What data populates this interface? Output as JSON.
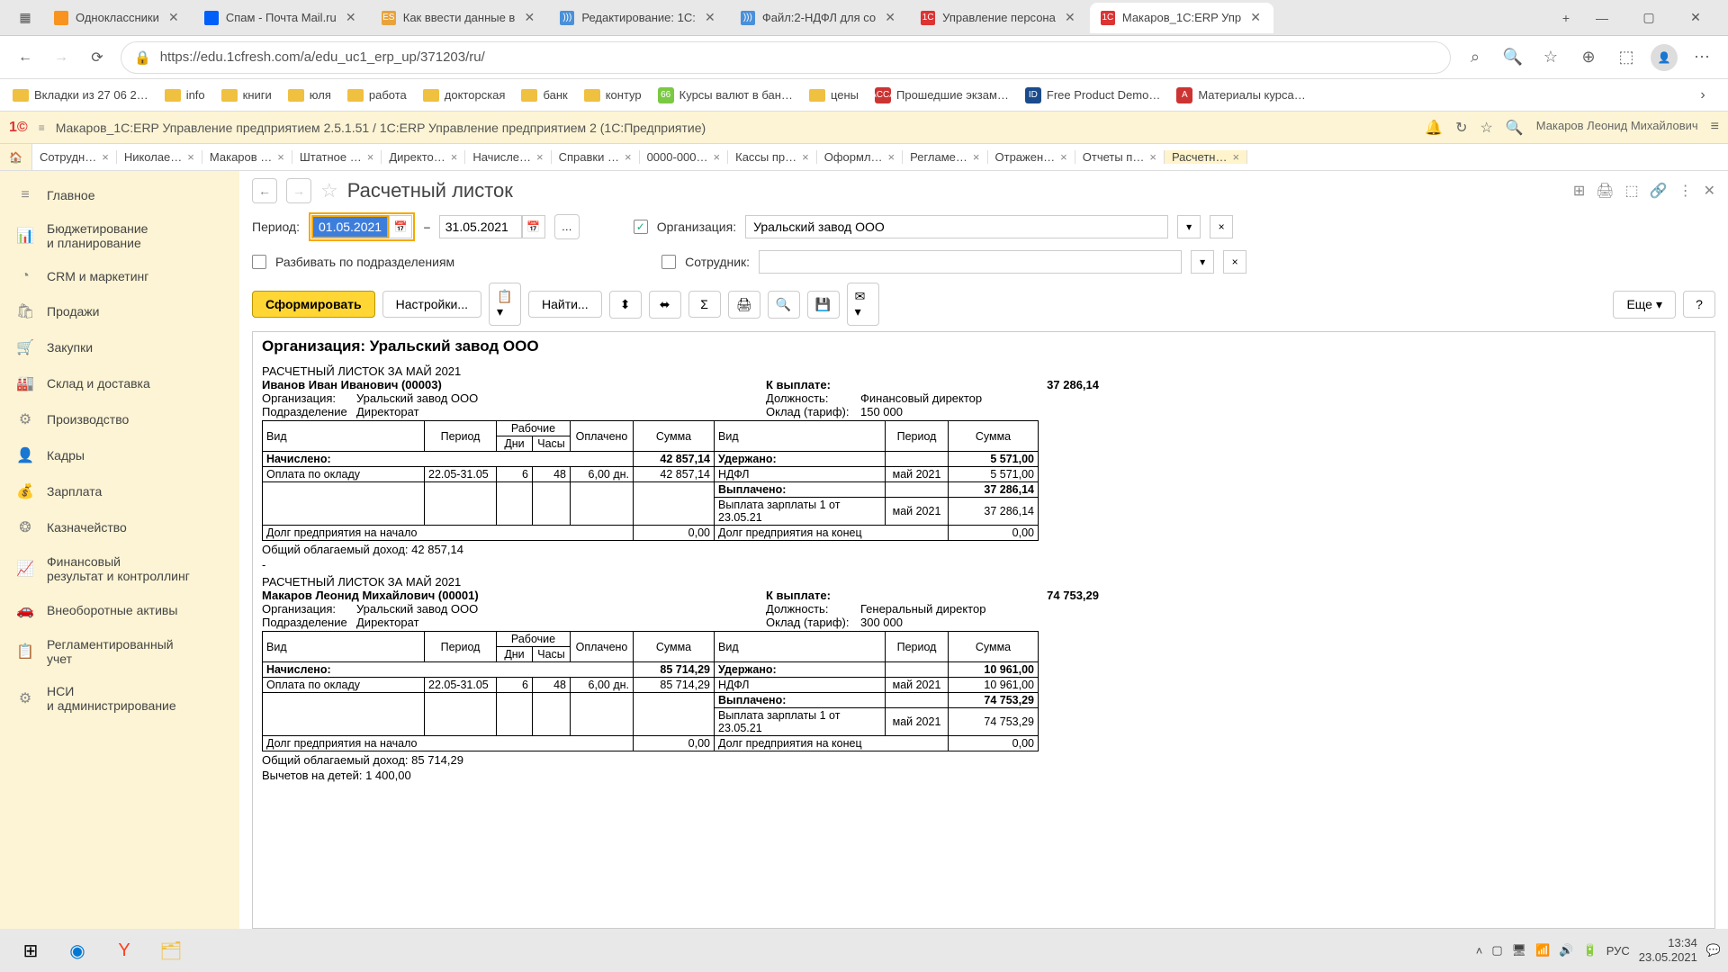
{
  "browser": {
    "tabs": [
      {
        "label": "Одноклассники",
        "color": "#f7931e"
      },
      {
        "label": "Спам - Почта Mail.ru",
        "color": "#005ff9"
      },
      {
        "label": "Как ввести данные в",
        "color": "#e8a33d",
        "initial": "ES"
      },
      {
        "label": "Редактирование: 1С:",
        "color": "#4a90d9",
        "initial": ")))"
      },
      {
        "label": "Файл:2-НДФЛ для со",
        "color": "#4a90d9",
        "initial": ")))"
      },
      {
        "label": "Управление персона",
        "color": "#d33",
        "initial": "1С"
      },
      {
        "label": "Макаров_1С:ERP Упр",
        "color": "#d33",
        "initial": "1С",
        "active": true
      }
    ],
    "url": "https://edu.1cfresh.com/a/edu_uc1_erp_up/371203/ru/",
    "bookmarks": [
      {
        "label": "Вкладки из 27 06 2…",
        "type": "folder"
      },
      {
        "label": "info",
        "type": "folder"
      },
      {
        "label": "книги",
        "type": "folder"
      },
      {
        "label": "юля",
        "type": "folder"
      },
      {
        "label": "работа",
        "type": "folder"
      },
      {
        "label": "докторская",
        "type": "folder"
      },
      {
        "label": "банк",
        "type": "folder"
      },
      {
        "label": "контур",
        "type": "folder"
      },
      {
        "label": "Курсы валют в бан…",
        "type": "link",
        "color": "#7ac943",
        "initial": "66"
      },
      {
        "label": "цены",
        "type": "folder"
      },
      {
        "label": "Прошедшие экзам…",
        "type": "link",
        "color": "#c33",
        "initial": "ACCA"
      },
      {
        "label": "Free Product Demo…",
        "type": "link",
        "color": "#1a4b8c",
        "initial": "ID"
      },
      {
        "label": "Материалы курса…",
        "type": "link",
        "color": "#c33",
        "initial": "А"
      }
    ]
  },
  "app": {
    "title": "Макаров_1С:ERP Управление предприятием 2.5.1.51 / 1С:ERP Управление предприятием 2   (1С:Предприятие)",
    "user": "Макаров Леонид Михайлович",
    "tabs": [
      "Сотрудн…",
      "Николае…",
      "Макаров …",
      "Штатное …",
      "Директо…",
      "Начисле…",
      "Справки …",
      "0000-000…",
      "Кассы пр…",
      "Оформл…",
      "Регламе…",
      "Отражен…",
      "Отчеты п…",
      "Расчетн…"
    ]
  },
  "sidebar": [
    {
      "label": "Главное",
      "icon": "≡"
    },
    {
      "label": "Бюджетирование\nи планирование",
      "icon": "📊"
    },
    {
      "label": "CRM и маркетинг",
      "icon": "◔"
    },
    {
      "label": "Продажи",
      "icon": "🛍"
    },
    {
      "label": "Закупки",
      "icon": "🛒"
    },
    {
      "label": "Склад и доставка",
      "icon": "🏭"
    },
    {
      "label": "Производство",
      "icon": "⚙"
    },
    {
      "label": "Кадры",
      "icon": "👤"
    },
    {
      "label": "Зарплата",
      "icon": "💰"
    },
    {
      "label": "Казначейство",
      "icon": "❂"
    },
    {
      "label": "Финансовый\nрезультат и контроллинг",
      "icon": "📈"
    },
    {
      "label": "Внеоборотные активы",
      "icon": "🚗"
    },
    {
      "label": "Регламентированный\nучет",
      "icon": "📋"
    },
    {
      "label": "НСИ\nи администрирование",
      "icon": "⚙"
    }
  ],
  "page": {
    "title": "Расчетный листок",
    "period_label": "Период:",
    "period_from": "01.05.2021",
    "period_to": "31.05.2021",
    "org_chk": "✓",
    "org_label": "Организация:",
    "org_value": "Уральский завод ООО",
    "split_label": "Разбивать по подразделениям",
    "empl_label": "Сотрудник:",
    "buttons": {
      "form": "Сформировать",
      "settings": "Настройки...",
      "find": "Найти...",
      "more": "Еще",
      "help": "?"
    }
  },
  "report": {
    "org_header": "Организация: Уральский завод ООО",
    "slip_period": "РАСЧЕТНЫЙ ЛИСТОК ЗА МАЙ 2021",
    "emp1": {
      "name": "Иванов Иван Иванович (00003)",
      "org_l": "Организация:",
      "org": "Уральский завод ООО",
      "dep_l": "Подразделение",
      "dep": "Директорат",
      "pay_l": "К выплате:",
      "pay": "37 286,14",
      "pos_l": "Должность:",
      "pos": "Финансовый директор",
      "sal_l": "Оклад (тариф):",
      "sal": "150 000",
      "headers": {
        "vid": "Вид",
        "period": "Период",
        "work": "Рабочие",
        "days": "Дни",
        "hours": "Часы",
        "paid": "Оплачено",
        "sum": "Сумма"
      },
      "acc_l": "Начислено:",
      "acc_sum": "42 857,14",
      "ded_l": "Удержано:",
      "ded_sum": "5 571,00",
      "row1": {
        "name": "Оплата по окладу",
        "period": "22.05-31.05",
        "days": "6",
        "hours": "48",
        "paid": "6,00 дн.",
        "sum": "42 857,14"
      },
      "ndfl": "НДФЛ",
      "ndfl_p": "май 2021",
      "ndfl_s": "5 571,00",
      "payout_l": "Выплачено:",
      "payout_s": "37 286,14",
      "payout_row": "Выплата зарплаты 1 от 23.05.21",
      "payout_p": "май 2021",
      "payout_rs": "37 286,14",
      "debt_start": "Долг предприятия на начало",
      "debt_start_v": "0,00",
      "debt_end": "Долг предприятия на конец",
      "debt_end_v": "0,00",
      "tax_income": "Общий облагаемый доход: 42 857,14"
    },
    "emp2": {
      "name": "Макаров Леонид Михайлович (00001)",
      "org_l": "Организация:",
      "org": "Уральский завод ООО",
      "dep_l": "Подразделение",
      "dep": "Директорат",
      "pay_l": "К выплате:",
      "pay": "74 753,29",
      "pos_l": "Должность:",
      "pos": "Генеральный директор",
      "sal_l": "Оклад (тариф):",
      "sal": "300 000",
      "acc_l": "Начислено:",
      "acc_sum": "85 714,29",
      "ded_l": "Удержано:",
      "ded_sum": "10 961,00",
      "row1": {
        "name": "Оплата по окладу",
        "period": "22.05-31.05",
        "days": "6",
        "hours": "48",
        "paid": "6,00 дн.",
        "sum": "85 714,29"
      },
      "ndfl": "НДФЛ",
      "ndfl_p": "май 2021",
      "ndfl_s": "10 961,00",
      "payout_l": "Выплачено:",
      "payout_s": "74 753,29",
      "payout_row": "Выплата зарплаты 1 от 23.05.21",
      "payout_p": "май 2021",
      "payout_rs": "74 753,29",
      "debt_start": "Долг предприятия на начало",
      "debt_start_v": "0,00",
      "debt_end": "Долг предприятия на конец",
      "debt_end_v": "0,00",
      "tax_income": "Общий облагаемый доход: 85 714,29",
      "deduct": "Вычетов на детей: 1 400,00"
    },
    "dash": "-"
  },
  "taskbar": {
    "lang": "РУС",
    "time": "13:34",
    "date": "23.05.2021"
  }
}
